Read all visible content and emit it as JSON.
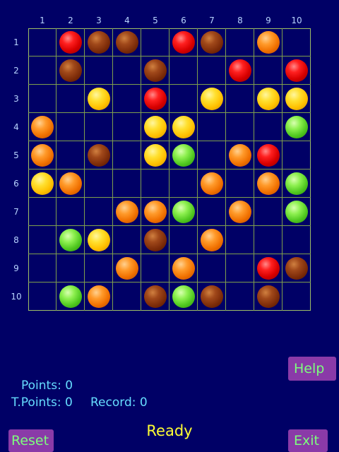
{
  "board": {
    "columns": [
      "1",
      "2",
      "3",
      "4",
      "5",
      "6",
      "7",
      "8",
      "9",
      "10"
    ],
    "rows": [
      "1",
      "2",
      "3",
      "4",
      "5",
      "6",
      "7",
      "8",
      "9",
      "10"
    ],
    "grid": [
      [
        "",
        "red",
        "brown",
        "brown",
        "",
        "red",
        "brown",
        "",
        "orange",
        ""
      ],
      [
        "",
        "brown",
        "",
        "",
        "brown",
        "",
        "",
        "red",
        "",
        "red"
      ],
      [
        "",
        "",
        "yellow",
        "",
        "red",
        "",
        "yellow",
        "",
        "yellow",
        "yellow"
      ],
      [
        "orange",
        "",
        "",
        "",
        "yellow",
        "yellow",
        "",
        "",
        "",
        "green"
      ],
      [
        "orange",
        "",
        "brown",
        "",
        "yellow",
        "green",
        "",
        "orange",
        "red",
        ""
      ],
      [
        "yellow",
        "orange",
        "",
        "",
        "",
        "",
        "orange",
        "",
        "orange",
        "green"
      ],
      [
        "",
        "",
        "",
        "orange",
        "orange",
        "green",
        "",
        "orange",
        "",
        "green"
      ],
      [
        "",
        "green",
        "yellow",
        "",
        "brown",
        "",
        "orange",
        "",
        "",
        ""
      ],
      [
        "",
        "",
        "",
        "orange",
        "",
        "orange",
        "",
        "",
        "red",
        "brown"
      ],
      [
        "",
        "green",
        "orange",
        "",
        "brown",
        "green",
        "brown",
        "",
        "brown",
        ""
      ]
    ]
  },
  "buttons": {
    "help": "Help",
    "reset": "Reset",
    "exit": "Exit"
  },
  "stats": {
    "points": "Points: 0",
    "total_points": "T.Points: 0",
    "record": "Record: 0"
  },
  "status": "Ready",
  "colors": {
    "background": "#000066",
    "grid_line": "#7f9f4c",
    "button": "#8a3aa8",
    "button_text": "#7dff7d",
    "stats_text": "#66ddff",
    "status_text": "#ffff33"
  }
}
